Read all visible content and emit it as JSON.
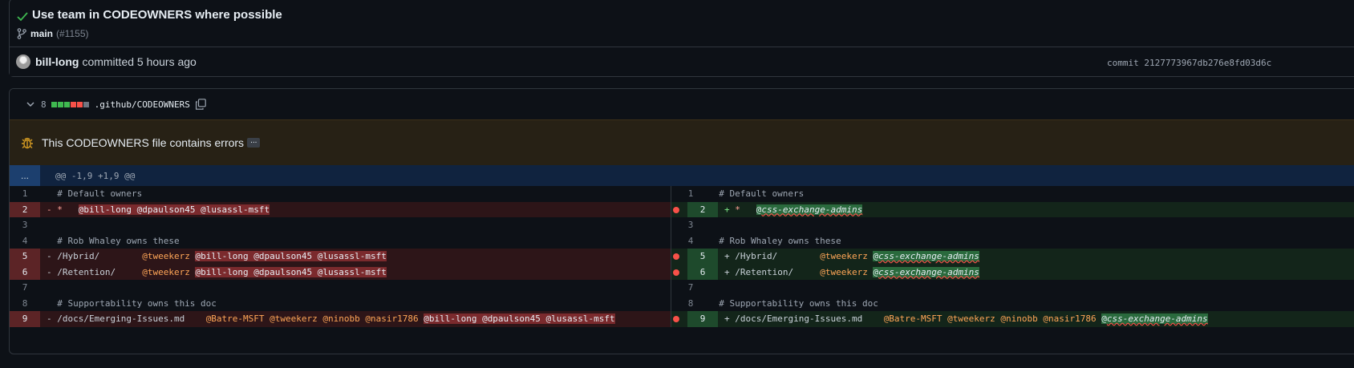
{
  "commit": {
    "title": "Use team in CODEOWNERS where possible",
    "branch": "main",
    "pr": "(#1155)",
    "author": "bill-long",
    "committed_text": "committed 5 hours ago",
    "hash_label": "commit 2127773967db276e8fd03d6c"
  },
  "file": {
    "changes": "8",
    "diffstat": [
      "#3fb950",
      "#3fb950",
      "#3fb950",
      "#f85149",
      "#f85149",
      "#6e7681"
    ],
    "name": ".github/CODEOWNERS",
    "error": "This CODEOWNERS file contains errors",
    "error_more": "...",
    "expand": "...",
    "hunk": "@@ -1,9 +1,9 @@"
  },
  "left_lines": [
    {
      "num": "1",
      "type": "ctx",
      "parts": [
        {
          "t": "  # Default owners",
          "c": "comment"
        }
      ]
    },
    {
      "num": "2",
      "type": "del",
      "parts": [
        {
          "t": "- ",
          "c": "sign-del"
        },
        {
          "t": "*",
          "c": "sign-del"
        },
        {
          "t": "   ",
          "c": ""
        },
        {
          "t": "@bill-long @dpaulson45 @lusassl-msft",
          "c": "hl-del"
        }
      ]
    },
    {
      "num": "3",
      "type": "ctx",
      "parts": [
        {
          "t": "",
          "c": ""
        }
      ]
    },
    {
      "num": "4",
      "type": "ctx",
      "parts": [
        {
          "t": "  # Rob Whaley owns these",
          "c": "comment"
        }
      ]
    },
    {
      "num": "5",
      "type": "del",
      "parts": [
        {
          "t": "- /Hybrid/        ",
          "c": ""
        },
        {
          "t": "@tweekerz ",
          "c": "orange"
        },
        {
          "t": "@bill-long @dpaulson45 @lusassl-msft",
          "c": "hl-del"
        }
      ]
    },
    {
      "num": "6",
      "type": "del",
      "parts": [
        {
          "t": "- /Retention/     ",
          "c": ""
        },
        {
          "t": "@tweekerz ",
          "c": "orange"
        },
        {
          "t": "@bill-long @dpaulson45 @lusassl-msft",
          "c": "hl-del"
        }
      ]
    },
    {
      "num": "7",
      "type": "ctx",
      "parts": [
        {
          "t": "",
          "c": ""
        }
      ]
    },
    {
      "num": "8",
      "type": "ctx",
      "parts": [
        {
          "t": "  # Supportability owns this doc",
          "c": "comment"
        }
      ]
    },
    {
      "num": "9",
      "type": "del",
      "parts": [
        {
          "t": "- /docs/Emerging-Issues.md    ",
          "c": ""
        },
        {
          "t": "@Batre-MSFT @tweekerz @ninobb @nasir1786 ",
          "c": "orange"
        },
        {
          "t": "@bill-long @dpaulson45 @lusassl-msft",
          "c": "hl-del"
        }
      ]
    }
  ],
  "right_lines": [
    {
      "num": "1",
      "type": "ctx",
      "parts": [
        {
          "t": "  # Default owners",
          "c": "comment"
        }
      ]
    },
    {
      "num": "2",
      "type": "add",
      "parts": [
        {
          "t": "+ ",
          "c": "sign-add"
        },
        {
          "t": "*",
          "c": "sign-del"
        },
        {
          "t": "   ",
          "c": ""
        },
        {
          "t": "@",
          "c": "hl-add orange"
        },
        {
          "t": "css-exchange-admins",
          "c": "hl-add squig"
        }
      ]
    },
    {
      "num": "3",
      "type": "ctx",
      "parts": [
        {
          "t": "",
          "c": ""
        }
      ]
    },
    {
      "num": "4",
      "type": "ctx",
      "parts": [
        {
          "t": "  # Rob Whaley owns these",
          "c": "comment"
        }
      ]
    },
    {
      "num": "5",
      "type": "add",
      "parts": [
        {
          "t": "+ /Hybrid/        ",
          "c": ""
        },
        {
          "t": "@tweekerz ",
          "c": "orange"
        },
        {
          "t": "@",
          "c": "hl-add orange"
        },
        {
          "t": "css-exchange-admins",
          "c": "hl-add squig"
        }
      ]
    },
    {
      "num": "6",
      "type": "add",
      "parts": [
        {
          "t": "+ /Retention/     ",
          "c": ""
        },
        {
          "t": "@tweekerz ",
          "c": "orange"
        },
        {
          "t": "@",
          "c": "hl-add orange"
        },
        {
          "t": "css-exchange-admins",
          "c": "hl-add squig"
        }
      ]
    },
    {
      "num": "7",
      "type": "ctx",
      "parts": [
        {
          "t": "",
          "c": ""
        }
      ]
    },
    {
      "num": "8",
      "type": "ctx",
      "parts": [
        {
          "t": "  # Supportability owns this doc",
          "c": "comment"
        }
      ]
    },
    {
      "num": "9",
      "type": "add",
      "parts": [
        {
          "t": "+ /docs/Emerging-Issues.md    ",
          "c": ""
        },
        {
          "t": "@Batre-MSFT @tweekerz @ninobb @nasir1786 ",
          "c": "orange"
        },
        {
          "t": "@",
          "c": "hl-add orange"
        },
        {
          "t": "css-exchange-admins",
          "c": "hl-add squig"
        }
      ]
    }
  ]
}
